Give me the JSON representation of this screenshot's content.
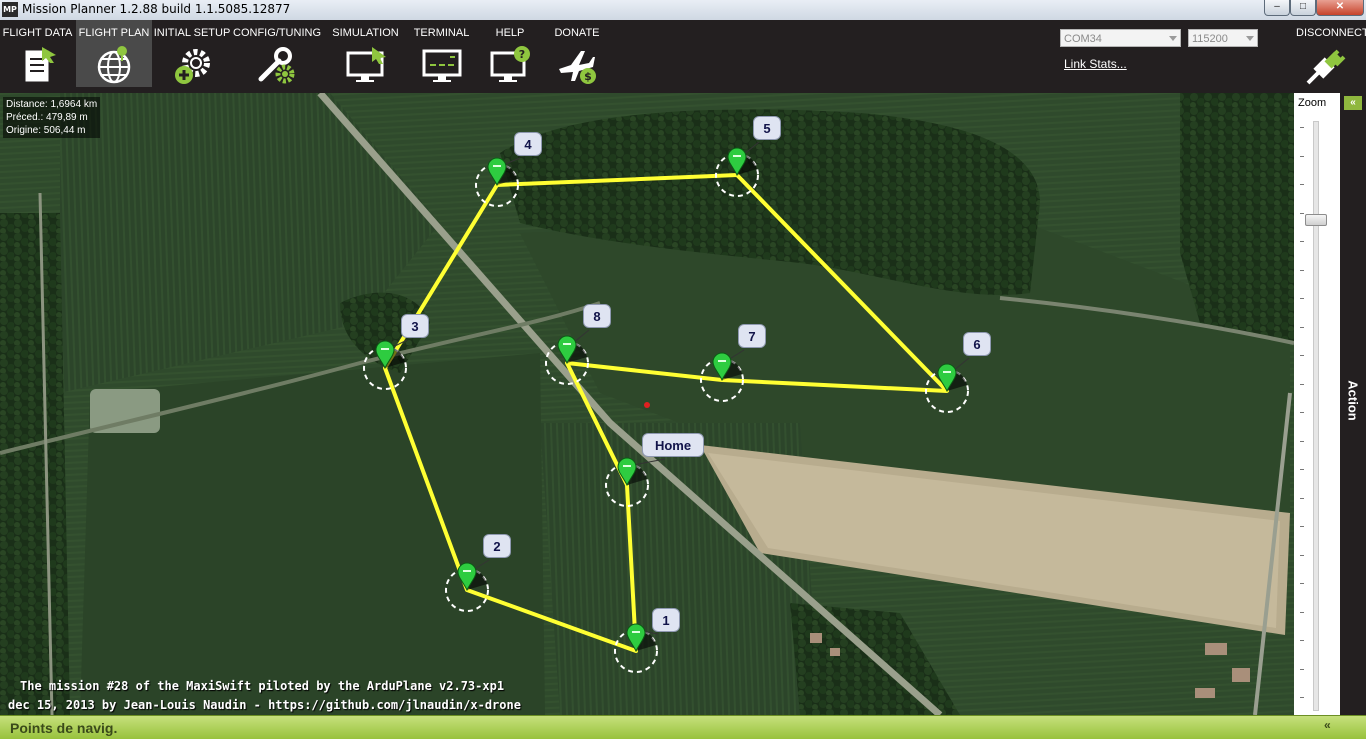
{
  "window": {
    "title": "Mission Planner 1.2.88 build 1.1.5085.12877",
    "icon_text": "MP",
    "minimize": "–",
    "maximize": "□",
    "close": "✕"
  },
  "toolbar": {
    "items": [
      {
        "label": "FLIGHT DATA",
        "icon": "flight-data-icon",
        "active": false
      },
      {
        "label": "FLIGHT PLAN",
        "icon": "flight-plan-globe-icon",
        "active": true
      },
      {
        "label": "INITIAL SETUP",
        "icon": "initial-setup-gear-icon",
        "active": false
      },
      {
        "label": "CONFIG/TUNING",
        "icon": "config-tuning-wrench-icon",
        "active": false
      },
      {
        "label": "SIMULATION",
        "icon": "simulation-monitor-icon",
        "active": false
      },
      {
        "label": "TERMINAL",
        "icon": "terminal-monitor-icon",
        "active": false
      },
      {
        "label": "HELP",
        "icon": "help-monitor-icon",
        "active": false
      },
      {
        "label": "DONATE",
        "icon": "donate-plane-icon",
        "active": false
      }
    ],
    "com_port": "COM34",
    "baud_rate": "115200",
    "link_stats": "Link Stats...",
    "disconnect": "DISCONNECT"
  },
  "map": {
    "stats": {
      "distance": "Distance: 1,6964 km",
      "prev": "Préced.: 479,89 m",
      "origin": "Origine: 506,44 m"
    },
    "waypoints": [
      {
        "label": "Home"
      },
      {
        "label": "1"
      },
      {
        "label": "2"
      },
      {
        "label": "3"
      },
      {
        "label": "4"
      },
      {
        "label": "5"
      },
      {
        "label": "6"
      },
      {
        "label": "7"
      },
      {
        "label": "8"
      }
    ],
    "caption_line1": "The mission #28 of the MaxiSwift piloted by the ArduPlane v2.73-xp1",
    "caption_line2": "dec 15, 2013 by Jean-Louis Naudin - https://github.com/jlnaudin/x-drone",
    "route_color": "#ffff33",
    "marker_color": "#2ecc40"
  },
  "zoom": {
    "label": "Zoom",
    "level": 0.16
  },
  "action_panel": {
    "label": "Action",
    "collapse": "«"
  },
  "bottom_bar": {
    "label": "Points de navig.",
    "expand": "«"
  }
}
